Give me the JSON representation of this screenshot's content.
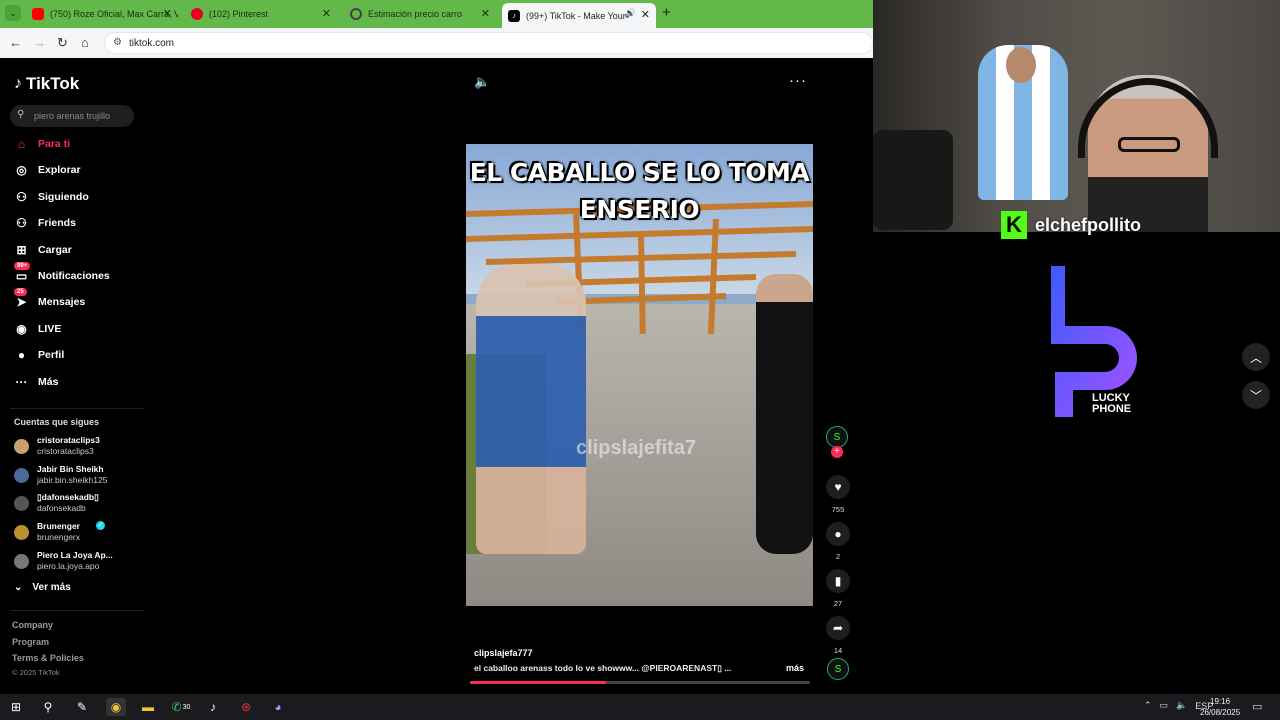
{
  "browser": {
    "tabs": [
      {
        "label": "(750) Roze Oficial, Max Carra, V",
        "icon_color": "#ff0000",
        "active": false
      },
      {
        "label": "(102) Pinterest",
        "icon_color": "#e60023",
        "active": false
      },
      {
        "label": "Estimación precio carro",
        "icon_color": "#444444",
        "active": false
      },
      {
        "label": "(99+) TikTok - Make Your Da",
        "icon_color": "#000000",
        "active": true
      }
    ],
    "url": "tiktok.com",
    "new_tab": "+"
  },
  "tiktok": {
    "brand": "TikTok",
    "search_placeholder": "piero arenas trujillo",
    "nav": [
      {
        "label": "Para ti",
        "icon": "home-icon",
        "glyph": "⌂",
        "active": true
      },
      {
        "label": "Explorar",
        "icon": "compass-icon",
        "glyph": "◎"
      },
      {
        "label": "Siguiendo",
        "icon": "following-icon",
        "glyph": "⚇"
      },
      {
        "label": "Friends",
        "icon": "friends-icon",
        "glyph": "⚇"
      },
      {
        "label": "Cargar",
        "icon": "upload-icon",
        "glyph": "⊞"
      },
      {
        "label": "Notificaciones",
        "icon": "inbox-icon",
        "glyph": "▭",
        "badge": "99+"
      },
      {
        "label": "Mensajes",
        "icon": "messages-icon",
        "glyph": "➤",
        "badge": "25"
      },
      {
        "label": "LIVE",
        "icon": "live-icon",
        "glyph": "◉"
      },
      {
        "label": "Perfil",
        "icon": "profile-icon",
        "glyph": "●"
      },
      {
        "label": "Más",
        "icon": "more-icon",
        "glyph": "···"
      }
    ],
    "following_title": "Cuentas que sigues",
    "following": [
      {
        "name": "cristorataclips3",
        "handle": "cristorataclips3",
        "color": "#c9a26a"
      },
      {
        "name": "Jabir Bin Sheikh",
        "handle": "jabir.bin.sheikh125",
        "color": "#4b6a9b"
      },
      {
        "name": "▯dafonsekadb▯",
        "handle": "dafonsekadb",
        "color": "#555555"
      },
      {
        "name": "Brunenger",
        "handle": "brunengerx",
        "color": "#b8902f",
        "verified": true
      },
      {
        "name": "Piero La Joya Ap...",
        "handle": "piero.la.joya.apo",
        "color": "#777777"
      }
    ],
    "ver_mas": "Ver más",
    "footer_links": [
      "Company",
      "Program",
      "Terms & Policies"
    ],
    "copyright": "© 2025 TikTok",
    "video": {
      "caption_line1": "EL CABALLO SE LO TOMA",
      "caption_line2": "ENSERIO",
      "watermark": "clipslajefita7",
      "author": "clipslajefa777",
      "description": "el caballoo arenass todo lo ve showww... @PIEROARENAST▯ ...",
      "more": "más",
      "progress_pct": 40,
      "actions": [
        {
          "icon": "heart-icon",
          "glyph": "♥",
          "count": "755"
        },
        {
          "icon": "comment-icon",
          "glyph": "●",
          "count": "2"
        },
        {
          "icon": "bookmark-icon",
          "glyph": "▮",
          "count": "27"
        },
        {
          "icon": "share-icon",
          "glyph": "➦",
          "count": "14"
        }
      ]
    }
  },
  "overlay": {
    "streamer_name": "elchefpollito",
    "kick_letter": "K",
    "sponsor_line1": "LUCKY",
    "sponsor_line2": "PHONE"
  },
  "taskbar": {
    "lang": "ESP",
    "time": "19:16",
    "date": "26/08/2025",
    "badge_count": "30"
  }
}
